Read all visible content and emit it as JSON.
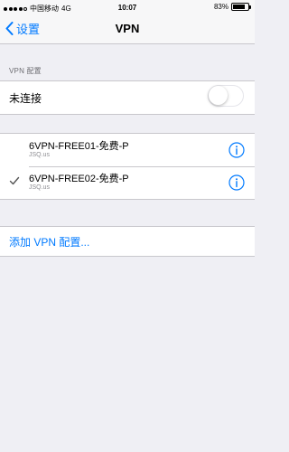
{
  "status_bar": {
    "carrier": "中国移动",
    "network": "4G",
    "time": "10:07",
    "battery": "83%",
    "battery_level": 0.83,
    "signal_bars": 4
  },
  "nav": {
    "back_label": "设置",
    "title": "VPN"
  },
  "vpn_config": {
    "header": "VPN 配置",
    "status_label": "未连接",
    "connected": false
  },
  "vpn_list": [
    {
      "name": "6VPN-FREE01-免费-P",
      "server": "JSQ.us",
      "selected": false
    },
    {
      "name": "6VPN-FREE02-免费-P",
      "server": "JSQ.us",
      "selected": true
    }
  ],
  "add_config_label": "添加 VPN 配置...",
  "colors": {
    "accent": "#007aff",
    "background": "#efeff4"
  }
}
